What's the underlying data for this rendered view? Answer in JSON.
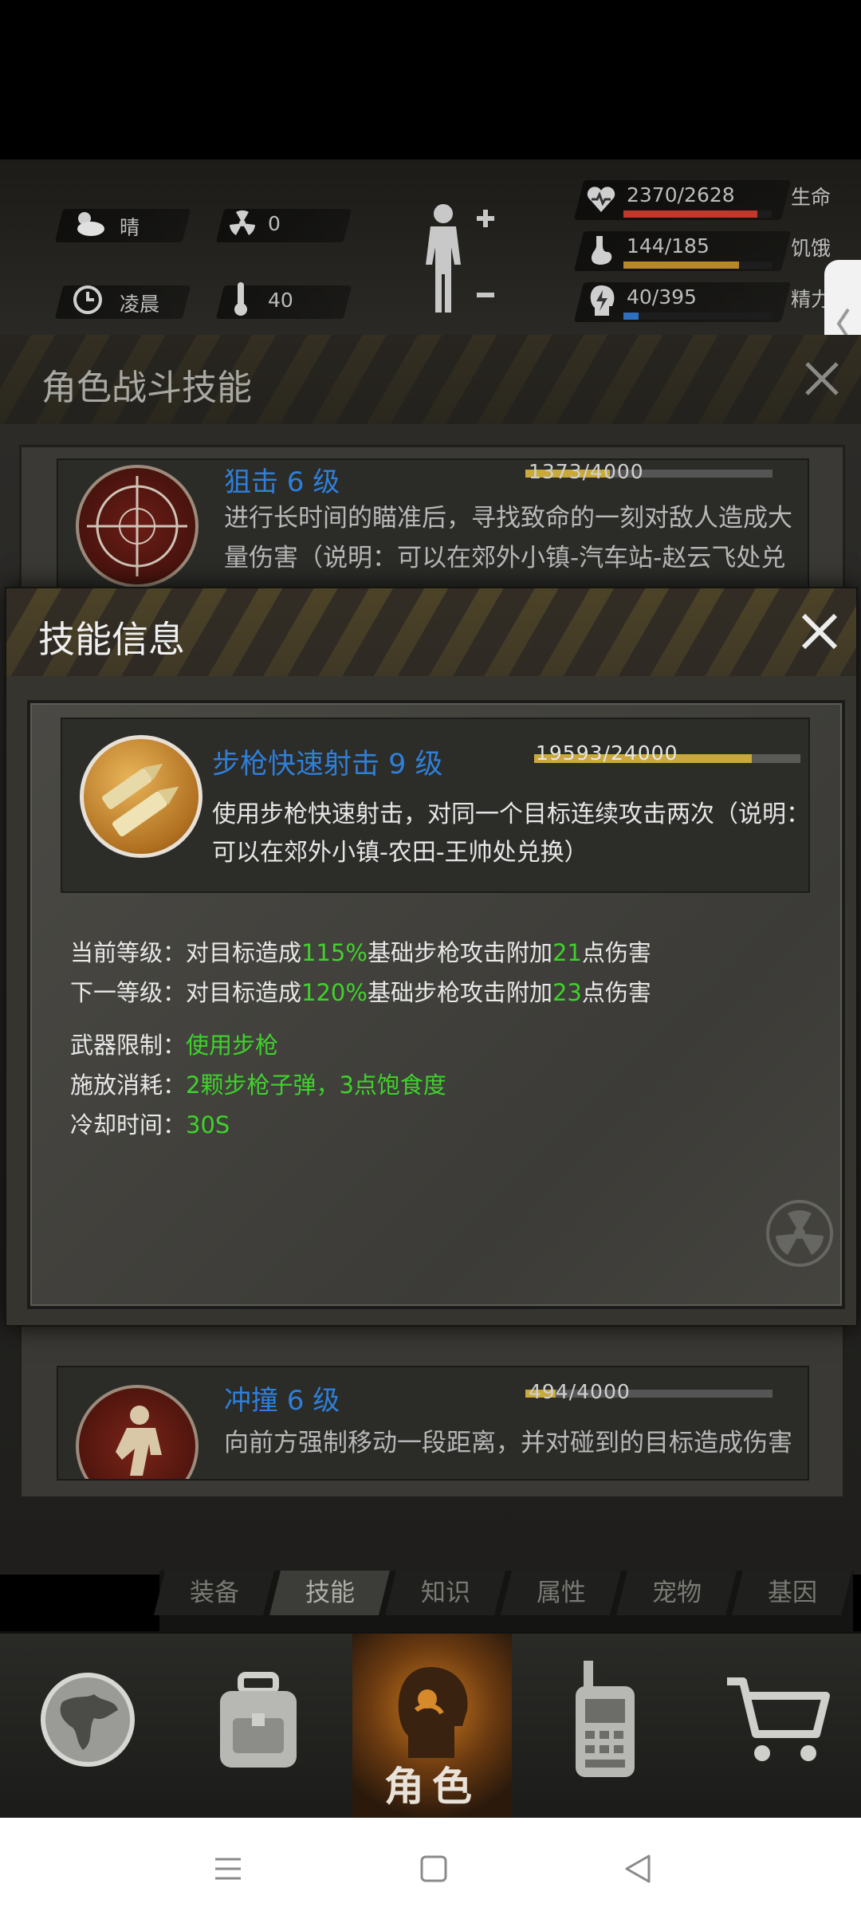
{
  "hud": {
    "weather": "晴",
    "radiation": "0",
    "time_of_day": "凌晨",
    "temperature": "40",
    "health": {
      "text": "2370/2628",
      "label": "生命",
      "fraction": 0.901,
      "color": "#c0392b"
    },
    "hunger": {
      "text": "144/185",
      "label": "饥饿",
      "fraction": 0.778,
      "color": "#b8862b"
    },
    "spirit": {
      "text": "40/395",
      "label": "精力",
      "fraction": 0.101,
      "color": "#2f6fc0"
    }
  },
  "base_panel": {
    "title": "角色战斗技能",
    "skills": [
      {
        "name": "狙击 6 级",
        "xp": "1373/4000",
        "xp_fraction": 0.343,
        "desc": "进行长时间的瞄准后，寻找致命的一刻对敌人造成大量伤害（说明：可以在郊外小镇-汽车站-赵云飞处兑"
      },
      {
        "name": "冲撞 6 级",
        "xp": "494/4000",
        "xp_fraction": 0.124,
        "desc": "向前方强制移动一段距离，并对碰到的目标造成伤害"
      }
    ]
  },
  "modal": {
    "title": "技能信息",
    "skill": {
      "name": "步枪快速射击 9 级",
      "xp": "19593/24000",
      "xp_fraction": 0.816,
      "desc_line1": "使用步枪快速射击，对同一个目标连续攻击两次（说明：",
      "desc_line2": "可以在郊外小镇-农田-王帅处兑换）"
    },
    "current_level": {
      "label": "当前等级：",
      "pre": "对目标造成",
      "pct": "115%",
      "mid": "基础步枪攻击附加",
      "num": "21",
      "post": "点伤害"
    },
    "next_level": {
      "label": "下一等级：",
      "pre": "对目标造成",
      "pct": "120%",
      "mid": "基础步枪攻击附加",
      "num": "23",
      "post": "点伤害"
    },
    "weapon_limit": {
      "label": "武器限制：",
      "value": "使用步枪"
    },
    "cast_cost": {
      "label": "施放消耗：",
      "value": "2颗步枪子弹，3点饱食度"
    },
    "cooldown": {
      "label": "冷却时间：",
      "value": "30S"
    }
  },
  "tabs": [
    "装备",
    "技能",
    "知识",
    "属性",
    "宠物",
    "基因"
  ],
  "active_tab": "技能",
  "nav": {
    "character_label": "角色"
  },
  "colors": {
    "skill_name_blue": "#2f7fd8",
    "value_green": "#3fd22c",
    "xp_gold": "#c9a93a"
  }
}
